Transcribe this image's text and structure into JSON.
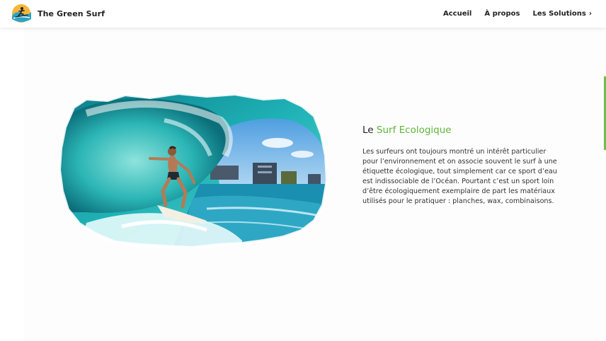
{
  "brand": {
    "name": "The Green Surf",
    "logo_icon": "surfer-logo-icon"
  },
  "nav": {
    "items": [
      {
        "label": "Accueil"
      },
      {
        "label": "À propos"
      },
      {
        "label": "Les Solutions",
        "chevron": "›"
      }
    ]
  },
  "hero": {
    "image_icon": "surfer-in-wave-photo",
    "heading_prefix": "Le ",
    "heading_accent": "Surf Ecologique",
    "paragraph": "Les surfeurs ont toujours montré un intérêt particulier pour l’environnement et on associe souvent le surf à une étiquette écologique, tout simplement car ce sport d’eau est indissociable de l’Océan. Pourtant c’est un sport loin d’être écologiquement exemplaire de part les matériaux utilisés pour le pratiquer : planches, wax, combinaisons."
  },
  "colors": {
    "accent": "#5fb53a",
    "scroll": "#6cc04a"
  }
}
